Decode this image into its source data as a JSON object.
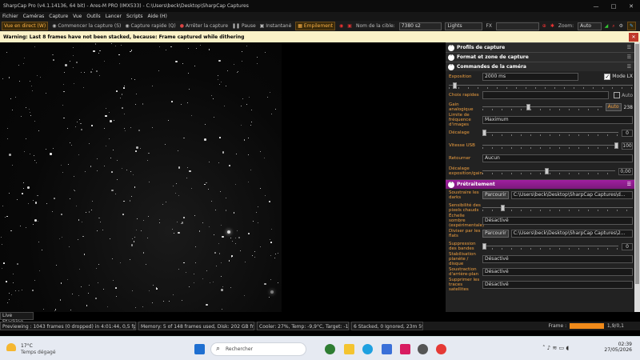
{
  "window": {
    "title": "SharpCap Pro (v4.1.14136, 64 bit) - Ares-M PRO (IMX533) - C:\\Users\\beck\\Desktop\\SharpCap Captures",
    "controls": [
      "—",
      "□",
      "✕"
    ]
  },
  "menu": [
    "Fichier",
    "Caméras",
    "Capture",
    "Vue",
    "Outils",
    "Lancer",
    "Scripts",
    "Aide (H)"
  ],
  "toolbar": {
    "live_view": "Vue en direct (W)",
    "start_capture": "Commencer la capture (S)",
    "quick_capture": "Capture rapide (Q)",
    "stop_capture": "Arrêter la capture",
    "pause": "Pause",
    "snapshot": "Instantané",
    "stack": "Empilement",
    "target_label": "Nom de la cible:",
    "target_value": "7380 s2",
    "frame_type": "Lights",
    "fx_label": "FX",
    "fx_value": "",
    "zoom_label": "Zoom:",
    "zoom_value": "Auto"
  },
  "warning": {
    "text": "Warning: Last 8 frames have not been stacked, because: Frame captured while dithering"
  },
  "viewport": {
    "tab_label": "Live Stacking"
  },
  "panel": {
    "sections": {
      "profiles": "Profils de capture",
      "format": "Format et zone de capture",
      "camera": "Commandes de la caméra",
      "processing": "Prétraitement"
    },
    "camera": {
      "exposure_label": "Exposition",
      "exposure_value": "2000 ms",
      "lx_label": "Mode LX",
      "lx_checked": true,
      "quick_choice_label": "Choix rapides",
      "quick_choice_value": "",
      "auto_label": "Auto",
      "gain_label": "Gain analogique",
      "gain_auto": "Auto",
      "gain_value": "238",
      "gain_level": 0.4,
      "framerate_label": "Limite de fréquence d'images",
      "framerate_value": "Maximum",
      "offset_label": "Décalage",
      "offset_value": "0",
      "usb_label": "Vitesse USB",
      "usb_value": "100",
      "usb_level": 1.0,
      "flip_label": "Retourner",
      "flip_value": "Aucun",
      "expgain_label": "Décalage exposition/gain",
      "expgain_value": "0,00",
      "expgain_level": 0.5
    },
    "processing": {
      "darks_label": "Soustraire les darks",
      "browse": "Parcourir",
      "darks_path": "C:\\Users\\beck\\Desktop\\SharpCap Captures\\d...",
      "hotpix_label": "Sensibilité des pixels chauds",
      "hotpix_level": 0.15,
      "darkscale_label": "Échelle sombre (expérimentale)",
      "disabled": "Désactivé",
      "flats_label": "Diviser par les flats",
      "flats_path": "C:\\Users\\beck\\Desktop\\SharpCap Captures\\2...",
      "banding_label": "Suppression des bandes",
      "banding_value": "0",
      "stab_label": "Stabilisation planète / disque",
      "bgsub_label": "Soustraction d'arrière-plan",
      "satellite_label": "Supprimer les traces satellites"
    }
  },
  "status": {
    "preview": "Previewing : 1043 frames (0 dropped) in 4:01:44, 0,5 fps",
    "memory": "Memory: 5 of 148 frames used, Disk: 202 GB free",
    "cooler": "Cooler: 27%, Temp: -9,9°C, Target: -10,0°C",
    "stacked": "6 Stacked, 0 Ignored, 23m 59s",
    "frame_label": "Frame :",
    "frame_progress": 0.95,
    "frame_value": "1,9/0,1"
  },
  "taskbar": {
    "temperature": "17°C",
    "weather": "Temps dégagé",
    "search_placeholder": "Rechercher",
    "time": "02:39",
    "date": "27/05/2026",
    "colors": {
      "start": "#1f6fd1",
      "files": "#f4c430",
      "edge": "#1ea0e0",
      "store": "#3a6fd8",
      "app1": "#2e7d32",
      "app2": "#d81b60",
      "sharpcap": "#555555",
      "chrome": "#e53935"
    }
  }
}
